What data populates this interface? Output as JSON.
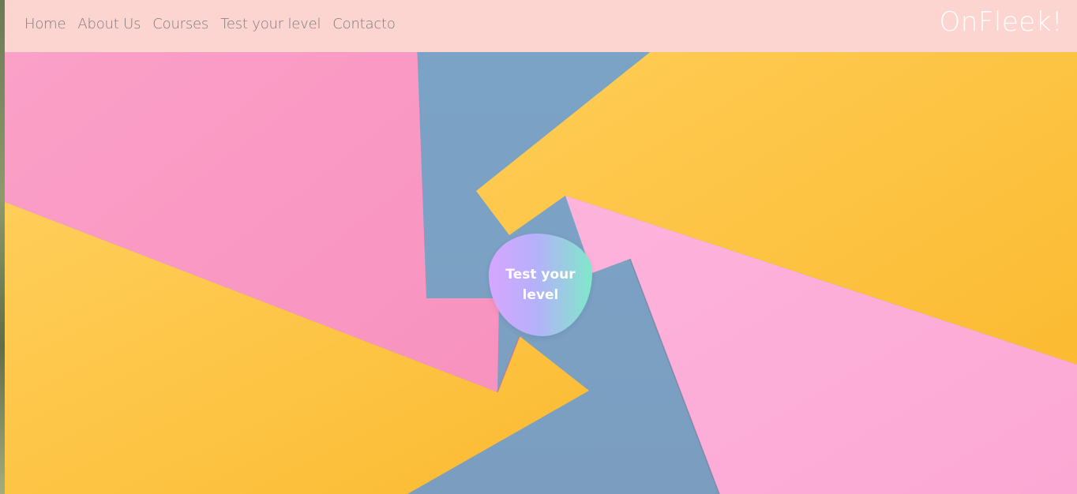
{
  "nav": {
    "links": [
      "Home",
      "About Us",
      "Courses",
      "Test your level",
      "Contacto"
    ],
    "brand": "OnFleek!"
  },
  "hero": {
    "cta_label": "Test your level",
    "colors": {
      "pink": "#fba3cc",
      "blue": "#7ba3c6",
      "yellow": "#fec851",
      "navbar": "#fdd5d0"
    }
  }
}
